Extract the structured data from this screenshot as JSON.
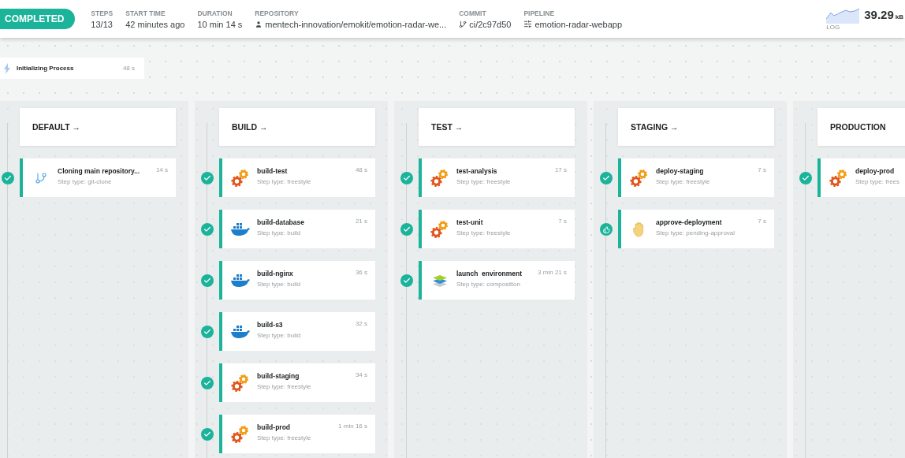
{
  "status": {
    "label": "COMPLETED"
  },
  "stats": [
    {
      "kind": "plain",
      "label": "STEPS",
      "value": "13/13"
    },
    {
      "kind": "plain",
      "label": "START TIME",
      "value": "42 minutes ago"
    },
    {
      "kind": "plain",
      "label": "DURATION",
      "value": "10 min 14 s"
    },
    {
      "kind": "repo",
      "label": "REPOSITORY",
      "value": "mentech-innovation/emokit/emotion-radar-we..."
    },
    {
      "kind": "commit",
      "label": "COMMIT",
      "value": "ci/2c97d50"
    },
    {
      "kind": "pipeline",
      "label": "PIPELINE",
      "value": "emotion-radar-webapp"
    }
  ],
  "log": {
    "label": "LOG",
    "value": "39.29",
    "unit": "kB"
  },
  "init": {
    "title": "Initializing Process",
    "duration": "48 s"
  },
  "stages": [
    {
      "title": "DEFAULT",
      "arrow": "→",
      "steps": [
        {
          "kind": "git",
          "succeeded": true,
          "name": "Cloning main repository...",
          "type": "Step type: git-clone",
          "duration": "14 s"
        }
      ]
    },
    {
      "title": "BUILD",
      "arrow": "→",
      "steps": [
        {
          "kind": "freestyle",
          "succeeded": true,
          "name": "build-test",
          "type": "Step type: freestyle",
          "duration": "48 s"
        },
        {
          "kind": "docker",
          "succeeded": true,
          "name": "build-database",
          "type": "Step type: build",
          "duration": "21 s"
        },
        {
          "kind": "docker",
          "succeeded": true,
          "name": "build-nginx",
          "type": "Step type: build",
          "duration": "36 s"
        },
        {
          "kind": "docker",
          "succeeded": true,
          "name": "build-s3",
          "type": "Step type: build",
          "duration": "32 s"
        },
        {
          "kind": "freestyle",
          "succeeded": true,
          "name": "build-staging",
          "type": "Step type: freestyle",
          "duration": "34 s"
        },
        {
          "kind": "freestyle",
          "succeeded": true,
          "name": "build-prod",
          "type": "Step type: freestyle",
          "duration": "1 min 16 s"
        }
      ]
    },
    {
      "title": "TEST",
      "arrow": "→",
      "steps": [
        {
          "kind": "freestyle",
          "succeeded": true,
          "name": "test-analysis",
          "type": "Step type: freestyle",
          "duration": "17 s"
        },
        {
          "kind": "freestyle",
          "succeeded": true,
          "name": "test-unit",
          "type": "Step type: freestyle",
          "duration": "7 s"
        },
        {
          "kind": "composition",
          "succeeded": true,
          "name": "launch  environment",
          "type": "Step type: composition",
          "duration": "3 min 21 s"
        }
      ]
    },
    {
      "title": "STAGING",
      "arrow": "→",
      "steps": [
        {
          "kind": "freestyle",
          "succeeded": true,
          "name": "deploy-staging",
          "type": "Step type: freestyle",
          "duration": "7 s"
        },
        {
          "kind": "approval",
          "succeeded": true,
          "name": "approve-deployment",
          "type": "Step type: pending-approval",
          "duration": "7 s"
        }
      ]
    },
    {
      "title": "PRODUCTION",
      "steps": [
        {
          "kind": "freestyle",
          "succeeded": true,
          "name": "deploy-prod",
          "type": "Step type: frees"
        }
      ]
    }
  ]
}
